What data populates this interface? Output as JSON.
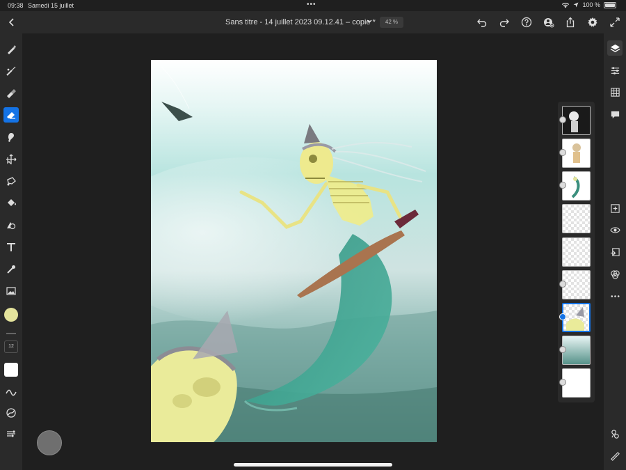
{
  "status": {
    "time": "09:38",
    "date": "Samedi 15 juillet",
    "battery": "100 %"
  },
  "topbar": {
    "title": "Sans titre - 14 juillet 2023 09.12.41 – copie *",
    "zoom": "42 %"
  },
  "left_toolbar": {
    "tools": [
      "brush-icon",
      "mixer-brush-icon",
      "eraser-brush-icon",
      "eraser-icon",
      "smudge-icon",
      "move-icon",
      "lasso-icon",
      "fill-icon",
      "shape-icon",
      "text-icon",
      "eyedropper-icon",
      "image-icon"
    ],
    "active_tool": "eraser-icon",
    "current_color": "#e4e39c",
    "brush_size": "12"
  },
  "right_toolbar": {
    "tools": [
      "layers-icon",
      "adjustments-icon",
      "grid-icon",
      "comments-icon",
      "add-layer-icon",
      "visibility-icon",
      "import-icon",
      "blend-icon",
      "more-icon",
      "hand-icon",
      "ruler-icon"
    ]
  },
  "layers": {
    "count": 9,
    "selected_index": 6
  },
  "colors": {
    "accent": "#1473e6",
    "panel": "#2a2a2a",
    "background": "#1f1f1f"
  }
}
